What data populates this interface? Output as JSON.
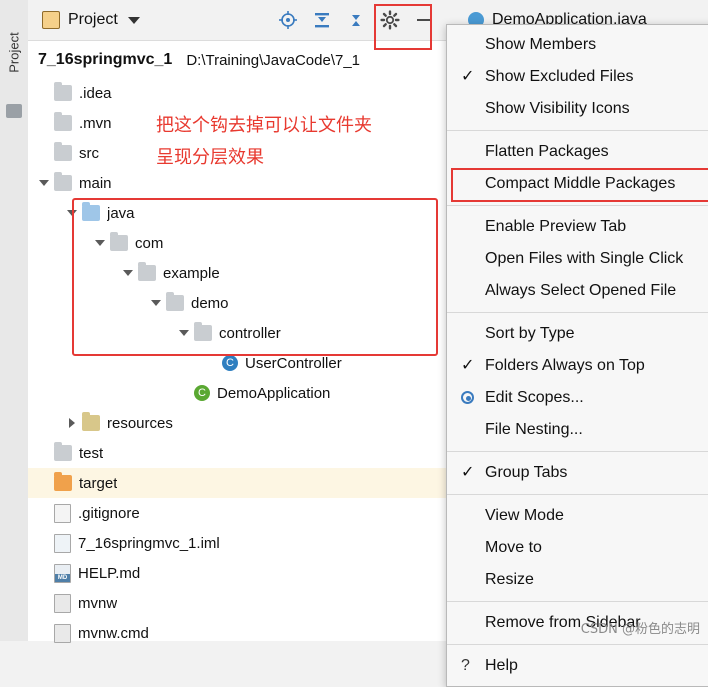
{
  "left_strip": {
    "tab_label": "Project"
  },
  "toolbar": {
    "project_label": "Project",
    "icons": [
      {
        "name": "target-icon",
        "glyph": "◎"
      },
      {
        "name": "collapse-to-icon",
        "glyph": "⤓"
      },
      {
        "name": "collapse-all-icon",
        "glyph": "⤒"
      },
      {
        "name": "gear-icon",
        "glyph": "⚙"
      },
      {
        "name": "hide-icon",
        "glyph": "—"
      }
    ],
    "editor_tab": "DemoApplication.java"
  },
  "project": {
    "name": "7_16springmvc_1",
    "path": "D:\\Training\\JavaCode\\7_1"
  },
  "annotation": {
    "note": "把这个钩去掉可以让文件夹\n呈现分层效果",
    "color": "#e8392f"
  },
  "tree": [
    {
      "indent": 0,
      "arrow": "none",
      "icon": "folder",
      "label": ".idea"
    },
    {
      "indent": 0,
      "arrow": "none",
      "icon": "folder",
      "label": ".mvn"
    },
    {
      "indent": 0,
      "arrow": "none",
      "icon": "folder",
      "label": "src"
    },
    {
      "indent": 0,
      "arrow": "down",
      "icon": "folder",
      "label": "main"
    },
    {
      "indent": 1,
      "arrow": "down",
      "icon": "folder-blue",
      "label": "java"
    },
    {
      "indent": 2,
      "arrow": "down",
      "icon": "folder",
      "label": "com"
    },
    {
      "indent": 3,
      "arrow": "down",
      "icon": "folder",
      "label": "example"
    },
    {
      "indent": 4,
      "arrow": "down",
      "icon": "folder",
      "label": "demo"
    },
    {
      "indent": 5,
      "arrow": "down",
      "icon": "folder",
      "label": "controller"
    },
    {
      "indent": 6,
      "arrow": "none",
      "icon": "class",
      "label": "UserController"
    },
    {
      "indent": 5,
      "arrow": "none",
      "icon": "class-spring",
      "label": "DemoApplication"
    },
    {
      "indent": 1,
      "arrow": "right",
      "icon": "folder-res",
      "label": "resources"
    },
    {
      "indent": 0,
      "arrow": "none",
      "icon": "folder",
      "label": "test"
    },
    {
      "indent": 0,
      "arrow": "none",
      "icon": "folder-orange",
      "label": "target"
    },
    {
      "indent": 0,
      "arrow": "none",
      "icon": "file-git",
      "label": ".gitignore"
    },
    {
      "indent": 0,
      "arrow": "none",
      "icon": "file-iml",
      "label": "7_16springmvc_1.iml"
    },
    {
      "indent": 0,
      "arrow": "none",
      "icon": "file-md",
      "label": "HELP.md"
    },
    {
      "indent": 0,
      "arrow": "none",
      "icon": "file",
      "label": "mvnw"
    },
    {
      "indent": 0,
      "arrow": "none",
      "icon": "file",
      "label": "mvnw.cmd"
    }
  ],
  "menu": {
    "items": [
      {
        "label": "Show Members",
        "mark": "none",
        "submenu": false
      },
      {
        "label": "Show Excluded Files",
        "mark": "check",
        "submenu": false
      },
      {
        "label": "Show Visibility Icons",
        "mark": "none",
        "submenu": false
      },
      {
        "separator": true
      },
      {
        "label": "Flatten Packages",
        "mark": "none",
        "submenu": false
      },
      {
        "label": "Compact Middle Packages",
        "mark": "none",
        "submenu": false,
        "highlight": true
      },
      {
        "separator": true
      },
      {
        "label": "Enable Preview Tab",
        "mark": "none",
        "submenu": false
      },
      {
        "label": "Open Files with Single Click",
        "mark": "none",
        "submenu": false
      },
      {
        "label": "Always Select Opened File",
        "mark": "none",
        "submenu": false
      },
      {
        "separator": true
      },
      {
        "label": "Sort by Type",
        "mark": "none",
        "submenu": false
      },
      {
        "label": "Folders Always on Top",
        "mark": "check",
        "submenu": false
      },
      {
        "label": "Edit Scopes...",
        "mark": "radio",
        "submenu": false
      },
      {
        "label": "File Nesting...",
        "mark": "none",
        "submenu": false
      },
      {
        "separator": true
      },
      {
        "label": "Group Tabs",
        "mark": "check",
        "submenu": false
      },
      {
        "separator": true
      },
      {
        "label": "View Mode",
        "mark": "none",
        "submenu": true
      },
      {
        "label": "Move to",
        "mark": "none",
        "submenu": true
      },
      {
        "label": "Resize",
        "mark": "none",
        "submenu": true
      },
      {
        "separator": true
      },
      {
        "label": "Remove from Sidebar",
        "mark": "none",
        "submenu": false
      },
      {
        "separator": true
      },
      {
        "label": "Help",
        "mark": "question",
        "submenu": false
      }
    ]
  },
  "watermark": "CSDN @粉色的志明"
}
